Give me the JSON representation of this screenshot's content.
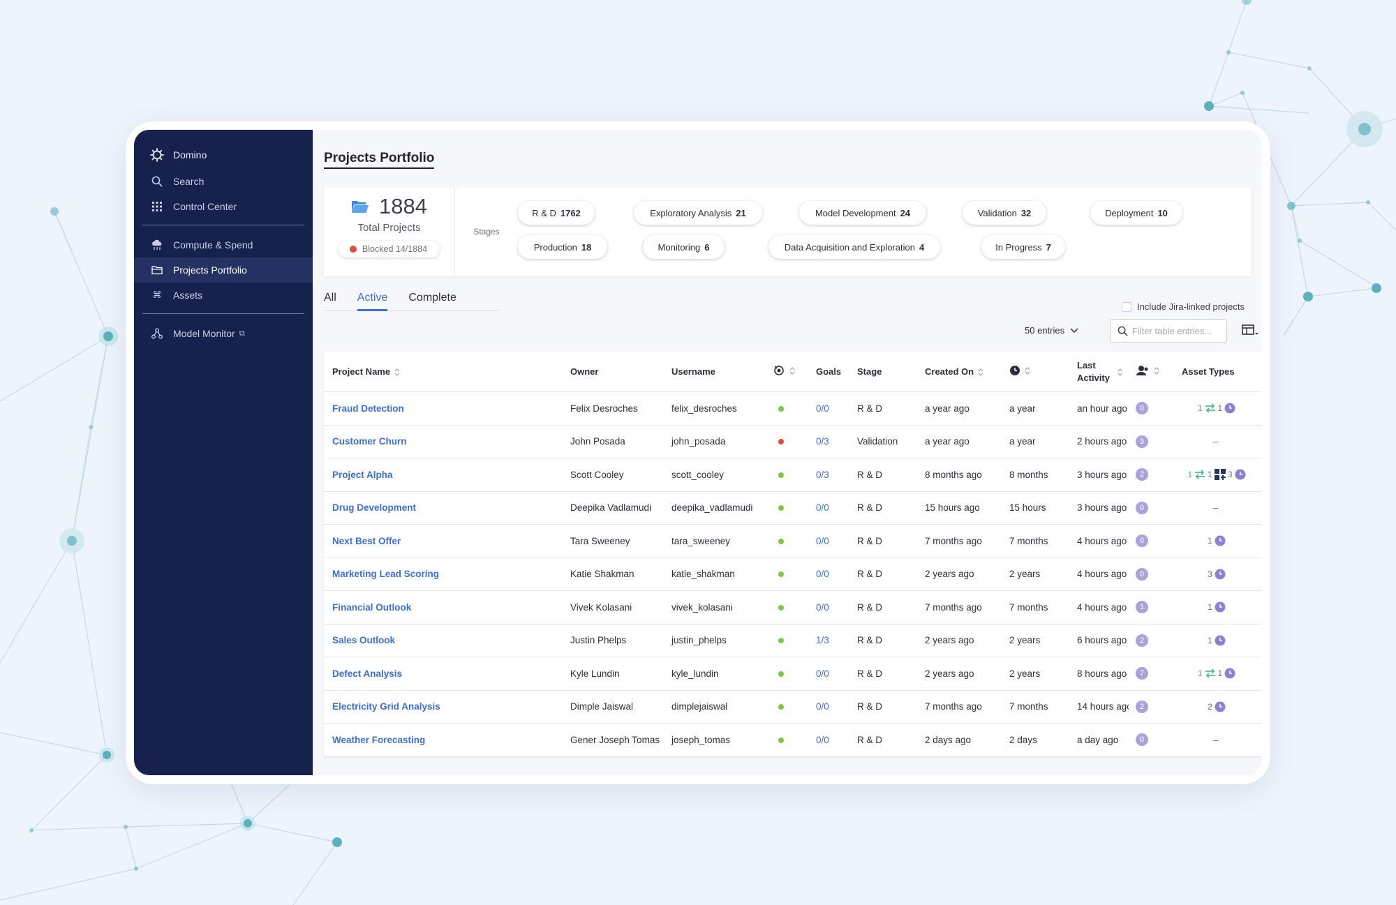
{
  "sidebar": {
    "brand": "Domino",
    "items": [
      {
        "label": "Search",
        "icon": "search-icon"
      },
      {
        "label": "Control Center",
        "icon": "grid-icon"
      },
      {
        "label": "Compute & Spend",
        "icon": "cloud-icon"
      },
      {
        "label": "Projects Portfolio",
        "icon": "folder-icon",
        "active": true
      },
      {
        "label": "Assets",
        "icon": "command-icon"
      },
      {
        "label": "Model Monitor",
        "icon": "model-icon",
        "external": true
      }
    ]
  },
  "page": {
    "title": "Projects Portfolio"
  },
  "summary": {
    "total": "1884",
    "total_label": "Total Projects",
    "blocked": "Blocked 14/1884",
    "stages_label": "Stages",
    "stages": [
      {
        "name": "R & D",
        "count": "1762"
      },
      {
        "name": "Exploratory Analysis",
        "count": "21"
      },
      {
        "name": "Model Development",
        "count": "24"
      },
      {
        "name": "Validation",
        "count": "32"
      },
      {
        "name": "Deployment",
        "count": "10"
      },
      {
        "name": "Production",
        "count": "18"
      },
      {
        "name": "Monitoring",
        "count": "6"
      },
      {
        "name": "Data Acquisition and Exploration",
        "count": "4"
      },
      {
        "name": "In Progress",
        "count": "7"
      }
    ]
  },
  "tabs": [
    "All",
    "Active",
    "Complete"
  ],
  "active_tab": "Active",
  "jira_label": "Include Jira-linked projects",
  "entries_label": "50 entries",
  "filter_placeholder": "Filter table entries...",
  "columns": {
    "name": "Project Name",
    "owner": "Owner",
    "username": "Username",
    "goals": "Goals",
    "stage": "Stage",
    "created": "Created On",
    "last_activity": "Last Activity",
    "assets": "Asset Types"
  },
  "colors": {
    "ok": "#7ac943",
    "blocked": "#e24b3c",
    "link": "#3b6fd8",
    "sidebar": "#17214d"
  },
  "rows": [
    {
      "name": "Fraud Detection",
      "owner": "Felix Desroches",
      "username": "felix_desroches",
      "status": "ok",
      "goals": "0/0",
      "stage": "R & D",
      "created": "a year ago",
      "duration": "a year",
      "last": "an hour ago",
      "collab": "0",
      "assets": [
        {
          "n": "1",
          "t": "sync"
        },
        {
          "n": "1",
          "t": "clock"
        }
      ]
    },
    {
      "name": "Customer Churn",
      "owner": "John Posada",
      "username": "john_posada",
      "status": "blocked",
      "goals": "0/3",
      "stage": "Validation",
      "created": "a year ago",
      "duration": "a year",
      "last": "2 hours ago",
      "collab": "3",
      "assets": []
    },
    {
      "name": "Project Alpha",
      "owner": "Scott Cooley",
      "username": "scott_cooley",
      "status": "ok",
      "goals": "0/3",
      "stage": "R & D",
      "created": "8 months ago",
      "duration": "8 months",
      "last": "3 hours ago",
      "collab": "2",
      "assets": [
        {
          "n": "1",
          "t": "sync"
        },
        {
          "n": "1",
          "t": "app"
        },
        {
          "n": "3",
          "t": "clock"
        }
      ]
    },
    {
      "name": "Drug Development",
      "owner": "Deepika Vadlamudi",
      "username": "deepika_vadlamudi",
      "status": "ok",
      "goals": "0/0",
      "stage": "R & D",
      "created": "15 hours ago",
      "duration": "15 hours",
      "last": "3 hours ago",
      "collab": "0",
      "assets": []
    },
    {
      "name": "Next Best Offer",
      "owner": "Tara Sweeney",
      "username": "tara_sweeney",
      "status": "ok",
      "goals": "0/0",
      "stage": "R & D",
      "created": "7 months ago",
      "duration": "7 months",
      "last": "4 hours ago",
      "collab": "0",
      "assets": [
        {
          "n": "1",
          "t": "clock"
        }
      ]
    },
    {
      "name": "Marketing Lead Scoring",
      "owner": "Katie Shakman",
      "username": "katie_shakman",
      "status": "ok",
      "goals": "0/0",
      "stage": "R & D",
      "created": "2 years ago",
      "duration": "2 years",
      "last": "4 hours ago",
      "collab": "0",
      "assets": [
        {
          "n": "3",
          "t": "clock"
        }
      ]
    },
    {
      "name": "Financial Outlook",
      "owner": "Vivek Kolasani",
      "username": "vivek_kolasani",
      "status": "ok",
      "goals": "0/0",
      "stage": "R & D",
      "created": "7 months ago",
      "duration": "7 months",
      "last": "4 hours ago",
      "collab": "1",
      "assets": [
        {
          "n": "1",
          "t": "clock"
        }
      ]
    },
    {
      "name": "Sales Outlook",
      "owner": "Justin Phelps",
      "username": "justin_phelps",
      "status": "ok",
      "goals": "1/3",
      "stage": "R & D",
      "created": "2 years ago",
      "duration": "2 years",
      "last": "6 hours ago",
      "collab": "2",
      "assets": [
        {
          "n": "1",
          "t": "clock"
        }
      ]
    },
    {
      "name": "Defect Analysis",
      "owner": "Kyle Lundin",
      "username": "kyle_lundin",
      "status": "ok",
      "goals": "0/0",
      "stage": "R & D",
      "created": "2 years ago",
      "duration": "2 years",
      "last": "8 hours ago",
      "collab": "7",
      "assets": [
        {
          "n": "1",
          "t": "sync"
        },
        {
          "n": "1",
          "t": "clock"
        }
      ]
    },
    {
      "name": "Electricity Grid Analysis",
      "owner": "Dimple Jaiswal",
      "username": "dimplejaiswal",
      "status": "ok",
      "goals": "0/0",
      "stage": "R & D",
      "created": "7 months ago",
      "duration": "7 months",
      "last": "14 hours agc",
      "collab": "2",
      "assets": [
        {
          "n": "2",
          "t": "clock"
        }
      ]
    },
    {
      "name": "Weather Forecasting",
      "owner": "Gener Joseph Tomas",
      "username": "joseph_tomas",
      "status": "ok",
      "goals": "0/0",
      "stage": "R & D",
      "created": "2 days ago",
      "duration": "2 days",
      "last": "a day ago",
      "collab": "0",
      "assets": []
    }
  ]
}
